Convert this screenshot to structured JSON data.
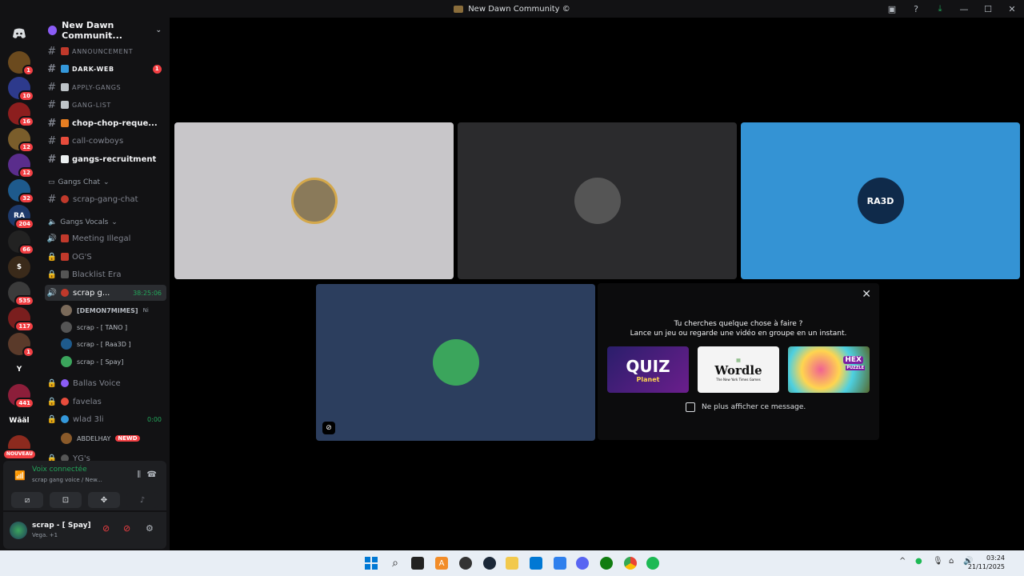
{
  "window": {
    "title": "New Dawn Community ©",
    "buttons": {
      "inbox": "▣",
      "help": "?",
      "download": "⤓",
      "minimize": "—",
      "maximize": "☐",
      "close": "✕"
    }
  },
  "guilds": [
    {
      "label": "",
      "badge": "1",
      "color": "#6b4a1e"
    },
    {
      "label": "",
      "badge": "10",
      "color": "#2d3a8c"
    },
    {
      "label": "",
      "badge": "16",
      "color": "#8c1e1e"
    },
    {
      "label": "",
      "badge": "12",
      "color": "#7a5d2b"
    },
    {
      "label": "",
      "badge": "12",
      "color": "#5a2d8c"
    },
    {
      "label": "",
      "badge": "32",
      "color": "#1e5a8c"
    },
    {
      "label": "RA",
      "badge": "204",
      "color": "#1e3a6b"
    },
    {
      "label": "",
      "badge": "66",
      "color": "#222222"
    },
    {
      "label": "$",
      "badge": "",
      "color": "#3a2a1a"
    },
    {
      "label": "",
      "badge": "535",
      "color": "#3b3b3b"
    },
    {
      "label": "",
      "badge": "117",
      "color": "#7a1e1e"
    },
    {
      "label": "",
      "badge": "1",
      "color": "#5a3a2a"
    },
    {
      "label": "Y",
      "badge": "",
      "color": "#121214"
    },
    {
      "label": "",
      "badge": "441",
      "color": "#8c1e3a"
    },
    {
      "label": "Wāäl",
      "badge": "",
      "color": "#121214"
    },
    {
      "label": "",
      "badge": "NOUVEAU",
      "color": "#8c2a1e"
    }
  ],
  "server": {
    "name": "New Dawn Communit...",
    "chevron": "⌄"
  },
  "channels": [
    {
      "name": "ANNOUNCEMENT",
      "type": "text",
      "style": "small",
      "emo": "#c0392b"
    },
    {
      "name": "DARK-WEB",
      "type": "text",
      "style": "small-bold",
      "emo": "#3498db",
      "mention": "1"
    },
    {
      "name": "APPLY-GANGS",
      "type": "text",
      "style": "small",
      "emo": "#bdc3c7"
    },
    {
      "name": "GANG-LIST",
      "type": "text",
      "style": "small",
      "emo": "#bdc3c7"
    },
    {
      "name": "chop-chop-reque...",
      "type": "text",
      "style": "bold",
      "emo": "#e67e22"
    },
    {
      "name": "call-cowboys",
      "type": "text",
      "style": "normal",
      "emo": "#e74c3c"
    },
    {
      "name": "gangs-recruitment",
      "type": "text",
      "style": "bold",
      "emo": "#ecf0f1"
    }
  ],
  "cat_gangs_chat": "Gangs Chat",
  "ch_scrap_chat": "scrap-gang-chat",
  "cat_gangs_vocals": "Gangs Vocals",
  "voice_channels": [
    {
      "name": "Meeting Illegal",
      "icon": "🔊"
    },
    {
      "name": "OG'S",
      "icon": "🔒"
    },
    {
      "name": "Blacklist Era",
      "icon": "🔒"
    }
  ],
  "active_voice": {
    "name": "scrap g...",
    "time": "38:25:06"
  },
  "voice_users": [
    {
      "name": "[DEMON7MIMES]",
      "extra": "Ni",
      "color": "#7a6a5a"
    },
    {
      "name": "scrap - [ TANO ]",
      "extra": "",
      "color": "#555555"
    },
    {
      "name": "scrap - [ Raa3D ]",
      "extra": "",
      "color": "#1e5a8c"
    },
    {
      "name": "scrap - [ Spay]",
      "extra": "",
      "color": "#3ba55c"
    }
  ],
  "voice_channels2": [
    {
      "name": "Ballas Voice",
      "dot": "#8b5cf6"
    },
    {
      "name": "favelas",
      "dot": "#e74c3c"
    },
    {
      "name": "wlad 3li",
      "dot": "#3498db",
      "time": "0:00"
    }
  ],
  "abdel_user": {
    "name": "ABDELHAY",
    "tag": "NEWD"
  },
  "yg_channel": "YG's",
  "voice_panel": {
    "status": "Voix connectée",
    "channel": "scrap gang voice / New..."
  },
  "user": {
    "name": "scrap - [ Spay]",
    "status": "Vega. +1"
  },
  "tiles": [
    {
      "name": "tile-user-1",
      "bg": "#c8c6c9",
      "avatar_bg": "#8a7a5a",
      "label": ""
    },
    {
      "name": "tile-user-2",
      "bg": "#2b2b2d",
      "avatar_bg": "#555555",
      "label": ""
    },
    {
      "name": "tile-user-3",
      "bg": "#3493d4",
      "avatar_bg": "#0f2a4a",
      "label": "RA3D"
    },
    {
      "name": "tile-user-4",
      "bg": "#2c3e5e",
      "avatar_bg": "#3ba55c",
      "label": ""
    }
  ],
  "activity": {
    "close": "✕",
    "line1": "Tu cherches quelque chose à faire ?",
    "line2": "Lance un jeu ou regarde une vidéo en groupe en un instant.",
    "cards": [
      {
        "title": "QUIZ",
        "sub": "Planet"
      },
      {
        "title": "Wordle",
        "sub": "The New York Times Games"
      },
      {
        "title": "HEX",
        "sub": "PUZZLE"
      }
    ],
    "checkbox_label": "Ne plus afficher ce message."
  },
  "clock": {
    "time": "03:24",
    "date": "21/11/2025"
  }
}
